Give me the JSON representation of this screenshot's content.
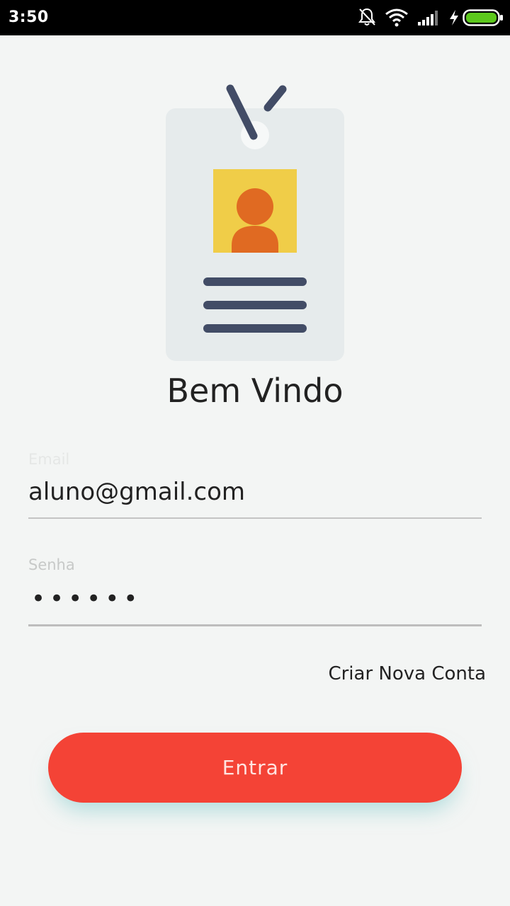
{
  "status_bar": {
    "time": "3:50",
    "icons": [
      "notifications-off-icon",
      "wifi-icon",
      "signal-icon",
      "charging-icon",
      "battery-icon"
    ]
  },
  "illustration": {
    "name": "id-badge-illustration",
    "colors": {
      "card": "#e6ebec",
      "strap": "#424c66",
      "photo_bg": "#f0cd48",
      "person": "#e06a22",
      "lines": "#424c66"
    }
  },
  "welcome": {
    "title": "Bem Vindo"
  },
  "form": {
    "email": {
      "label": "Email",
      "value": "aluno@gmail.com"
    },
    "password": {
      "label": "Senha",
      "masked_value": "••••••"
    }
  },
  "links": {
    "create_account": "Criar Nova Conta"
  },
  "buttons": {
    "enter": "Entrar"
  },
  "colors": {
    "background": "#f3f5f4",
    "primary": "#f44336",
    "status_bar": "#000000",
    "battery": "#5cc81c"
  }
}
